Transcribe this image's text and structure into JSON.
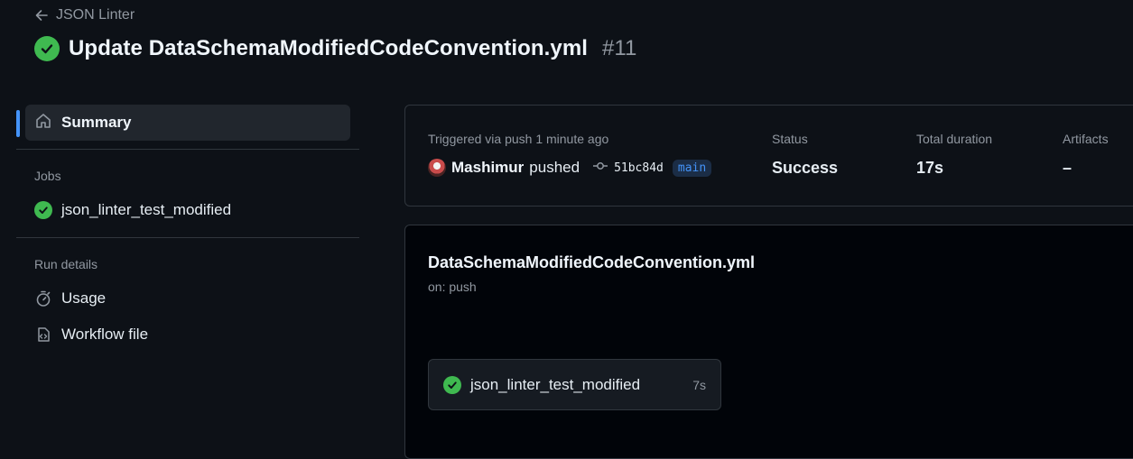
{
  "breadcrumb": {
    "back_label": "JSON Linter"
  },
  "header": {
    "title": "Update DataSchemaModifiedCodeConvention.yml",
    "run_number": "#11"
  },
  "sidebar": {
    "summary_label": "Summary",
    "jobs_heading": "Jobs",
    "jobs": [
      {
        "label": "json_linter_test_modified",
        "status": "success"
      }
    ],
    "run_details_heading": "Run details",
    "run_details": [
      {
        "label": "Usage",
        "icon": "stopwatch-icon"
      },
      {
        "label": "Workflow file",
        "icon": "file-code-icon"
      }
    ]
  },
  "run_info": {
    "trigger_label": "Triggered via push 1 minute ago",
    "author": "Mashimur",
    "action": "pushed",
    "commit_sha": "51bc84d",
    "branch": "main",
    "status_label": "Status",
    "status_value": "Success",
    "duration_label": "Total duration",
    "duration_value": "17s",
    "artifacts_label": "Artifacts",
    "artifacts_value": "–"
  },
  "workflow": {
    "file_name": "DataSchemaModifiedCodeConvention.yml",
    "on": "on: push",
    "jobs": [
      {
        "name": "json_linter_test_modified",
        "duration": "7s",
        "status": "success"
      }
    ]
  },
  "colors": {
    "background": "#0d1117",
    "success": "#3fb950",
    "accent": "#4493f8",
    "border": "#30363d",
    "muted_text": "#9198a1"
  }
}
